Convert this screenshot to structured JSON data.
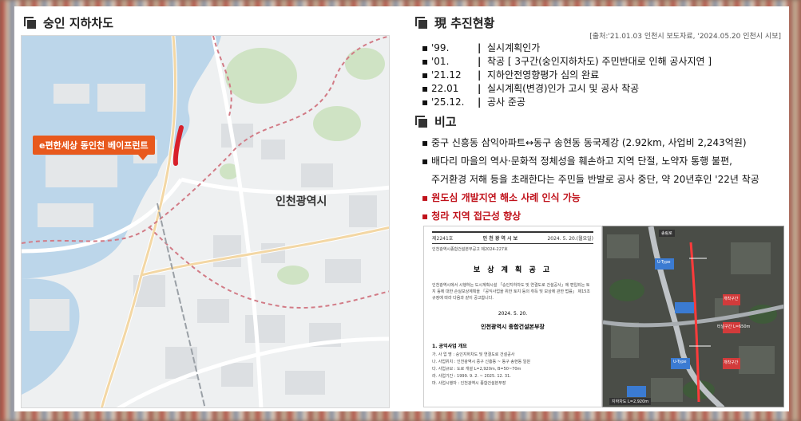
{
  "left": {
    "title": "숭인 지하차도",
    "callout": "e편한세상 동인천 베이프런트",
    "city_label": "인천광역시"
  },
  "status": {
    "title": "現 추진현황",
    "source": "[출처:'21.01.03 인천시 보도자료, '2024.05.20 인천시 시보]",
    "items": [
      {
        "year": "'99.",
        "text": "실시계획인가"
      },
      {
        "year": "'01.",
        "text": "착공 [ 3구간(숭인지하차도) 주민반대로 인해 공사지연 ]"
      },
      {
        "year": "'21.12",
        "text": "지하안전영향평가 심의 완료"
      },
      {
        "year": "22.01",
        "text": "실시계획(변경)인가 고시 및 공사 착공"
      },
      {
        "year": "'25.12.",
        "text": "공사 준공"
      }
    ]
  },
  "notes": {
    "title": "비고",
    "items": [
      {
        "text": "▪ 중구 신흥동 삼익아파트↔동구 송현동 동국제강 (2.92km, 사업비 2,243억원)",
        "red": false
      },
      {
        "text": "▪ 배다리 마을의 역사·문화적 정체성을 훼손하고 지역 단절, 노약자 통행 불편,",
        "red": false
      },
      {
        "text": "주거환경 저해 등을 초래한다는 주민들 반발로 공사 중단, 약 20년후인 '22년 착공",
        "red": false,
        "indent": true
      },
      {
        "text": "▪ 원도심 개발지연 해소 사례 인식 가능",
        "red": true
      },
      {
        "text": "▪ 청라 지역 접근성 향상",
        "red": true
      }
    ]
  },
  "doc": {
    "head_left": "제2241호",
    "head_center": "인 천 광 역 시 보",
    "head_right": "2024. 5. 20.(월요일)",
    "notice_no": "인천광역시종합건설본부공고 제2024-227호",
    "title": "보 상 계 획 공 고",
    "body": "인천광역시에서 시행하는 도시계획시설 「숭인지하차도 및 연결도로 건설공사」에 편입되는 토지 등에 대한 손실보상계획을 「공익사업을 위한 토지 등의 취득 및 보상에 관한 법률」 제15조 규정에 따라 다음과 같이 공고합니다.",
    "date": "2024. 5. 20.",
    "org": "인천광역시 종합건설본부장",
    "section": "1. 공익사업 개요",
    "rows": [
      "가. 사 업 명 : 숭인지하차도 및 연결도로 건설공사",
      "나. 사업위치 : 인천광역시 중구 신흥동 ~ 동구 송현동 일원",
      "다. 사업규모 : 도로 개설 L=2,920m, B=50~70m",
      "라. 사업기간 : 1999. 9. 2. ~ 2025. 12. 31.",
      "마. 사업시행자 : 인천광역시 종합건설본부장"
    ]
  },
  "sat": {
    "tags": [
      "송림로",
      "개착구간",
      "터널구간 L=650m",
      "개착구간",
      "U-Type",
      "U-Type",
      "지하차도 L=2,920m"
    ]
  }
}
